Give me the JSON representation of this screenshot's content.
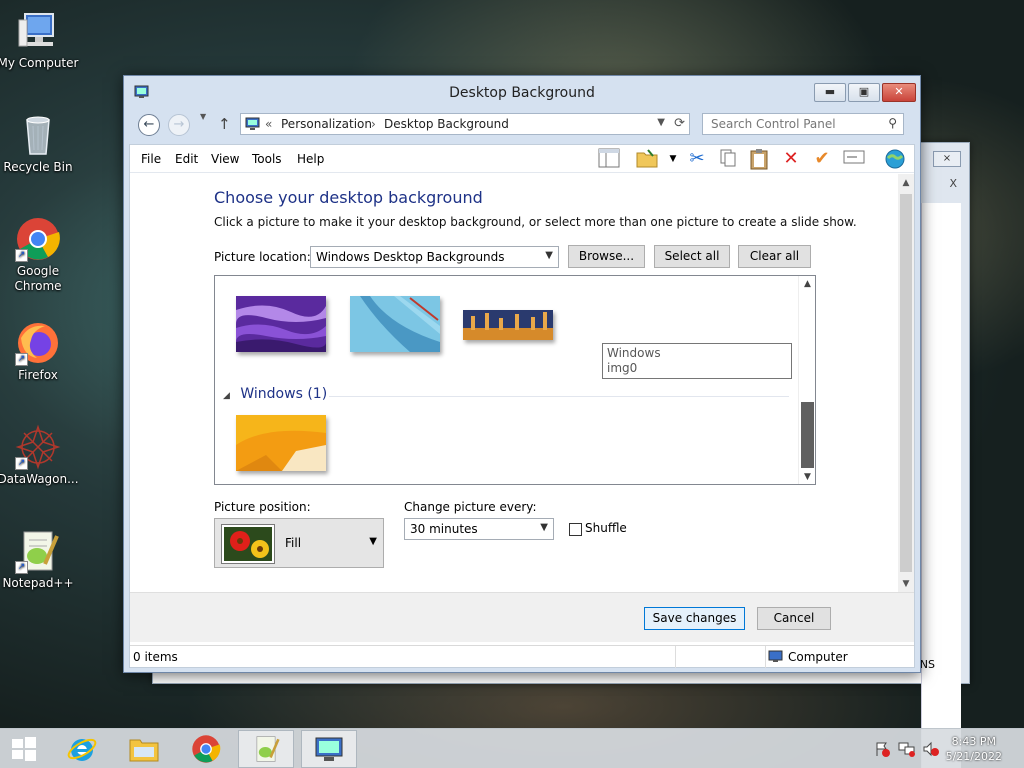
{
  "desktop": {
    "icons": [
      {
        "label": "My Computer"
      },
      {
        "label": "Recycle Bin"
      },
      {
        "label": "Google Chrome"
      },
      {
        "label": "Firefox"
      },
      {
        "label": "DataWagon..."
      },
      {
        "label": "Notepad++"
      }
    ]
  },
  "back_window": {
    "close_glyph": "×",
    "x_glyph": "X",
    "edge_text": "NS"
  },
  "window": {
    "title": "Desktop Background",
    "controls": {
      "minimize": "▬",
      "maximize": "▣",
      "close": "✕"
    },
    "address": {
      "back_glyph": "←",
      "forward_glyph": "→",
      "up_glyph": "↑",
      "prefix": "«",
      "crumbs": [
        "Personalization",
        "Desktop Background"
      ],
      "separator": "›",
      "search_placeholder": "Search Control Panel"
    },
    "menu": [
      "File",
      "Edit",
      "View",
      "Tools",
      "Help"
    ],
    "page": {
      "heading": "Choose your desktop background",
      "subtext": "Click a picture to make it your desktop background, or select more than one picture to create a slide show.",
      "location_label": "Picture location:",
      "location_value": "Windows Desktop Backgrounds",
      "browse": "Browse...",
      "select_all": "Select all",
      "clear_all": "Clear all",
      "group_label": "Windows (1)",
      "tooltip_line1": "Windows",
      "tooltip_line2": "img0",
      "position_label": "Picture position:",
      "position_value": "Fill",
      "change_label": "Change picture every:",
      "change_value": "30 minutes",
      "shuffle_label": "Shuffle",
      "shuffle_checked": false
    },
    "footer": {
      "save": "Save changes",
      "cancel": "Cancel"
    },
    "status": {
      "items": "0 items",
      "location": "Computer"
    }
  },
  "taskbar": {
    "clock_time": "8:43 PM",
    "clock_date": "5/21/2022"
  },
  "colors": {
    "accent_heading": "#1e3287",
    "close_red": "#c9443a"
  }
}
